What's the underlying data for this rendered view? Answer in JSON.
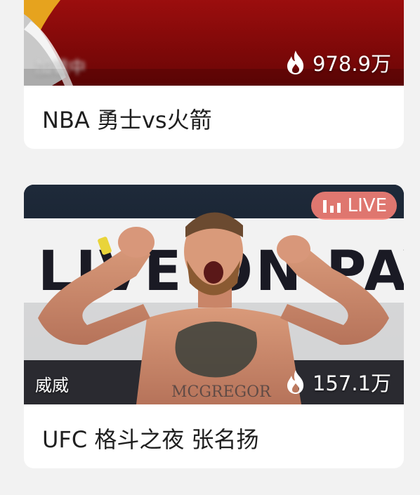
{
  "cards": [
    {
      "title": "NBA  勇士vs火箭",
      "author": "加载中",
      "views": "978.9万",
      "views_icon": "flame-icon",
      "colors": {
        "thumb": "#8a0b0b",
        "accent": "#f0b020"
      }
    },
    {
      "title": "UFC 格斗之夜 张名扬",
      "author": "威威",
      "views": "157.1万",
      "views_icon": "flame-icon",
      "live_label": "LIVE",
      "live_icon": "signal-bars-icon",
      "banner_text": "LIVE ON PAY-",
      "colors": {
        "live_badge": "#f77f75",
        "banner": "#f5f5f5",
        "banner_text": "#1a1a24"
      }
    }
  ]
}
